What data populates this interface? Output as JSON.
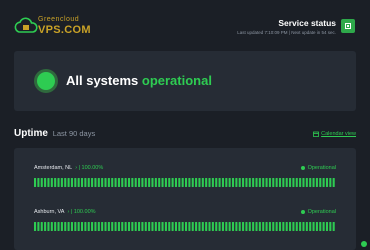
{
  "logo": {
    "small": "Greencloud",
    "big": "VPS.COM"
  },
  "header": {
    "title": "Service status",
    "meta": "Last updated 7:10:09 PM | Next update in 54 sec."
  },
  "status": {
    "prefix": "All systems",
    "highlight": "operational"
  },
  "uptime": {
    "title": "Uptime",
    "subtitle": "Last 90 days",
    "calendar_label": "Calendar view",
    "monitors": [
      {
        "location": "Amsterdam, NL",
        "percent": "100.00%",
        "status": "Operational",
        "days": 90
      },
      {
        "location": "Ashburn, VA",
        "percent": "100.00%",
        "status": "Operational",
        "days": 90
      }
    ]
  },
  "colors": {
    "accent": "#2ecc52",
    "background": "#1b1f26",
    "card": "#262c35",
    "brand": "#c9a227"
  }
}
